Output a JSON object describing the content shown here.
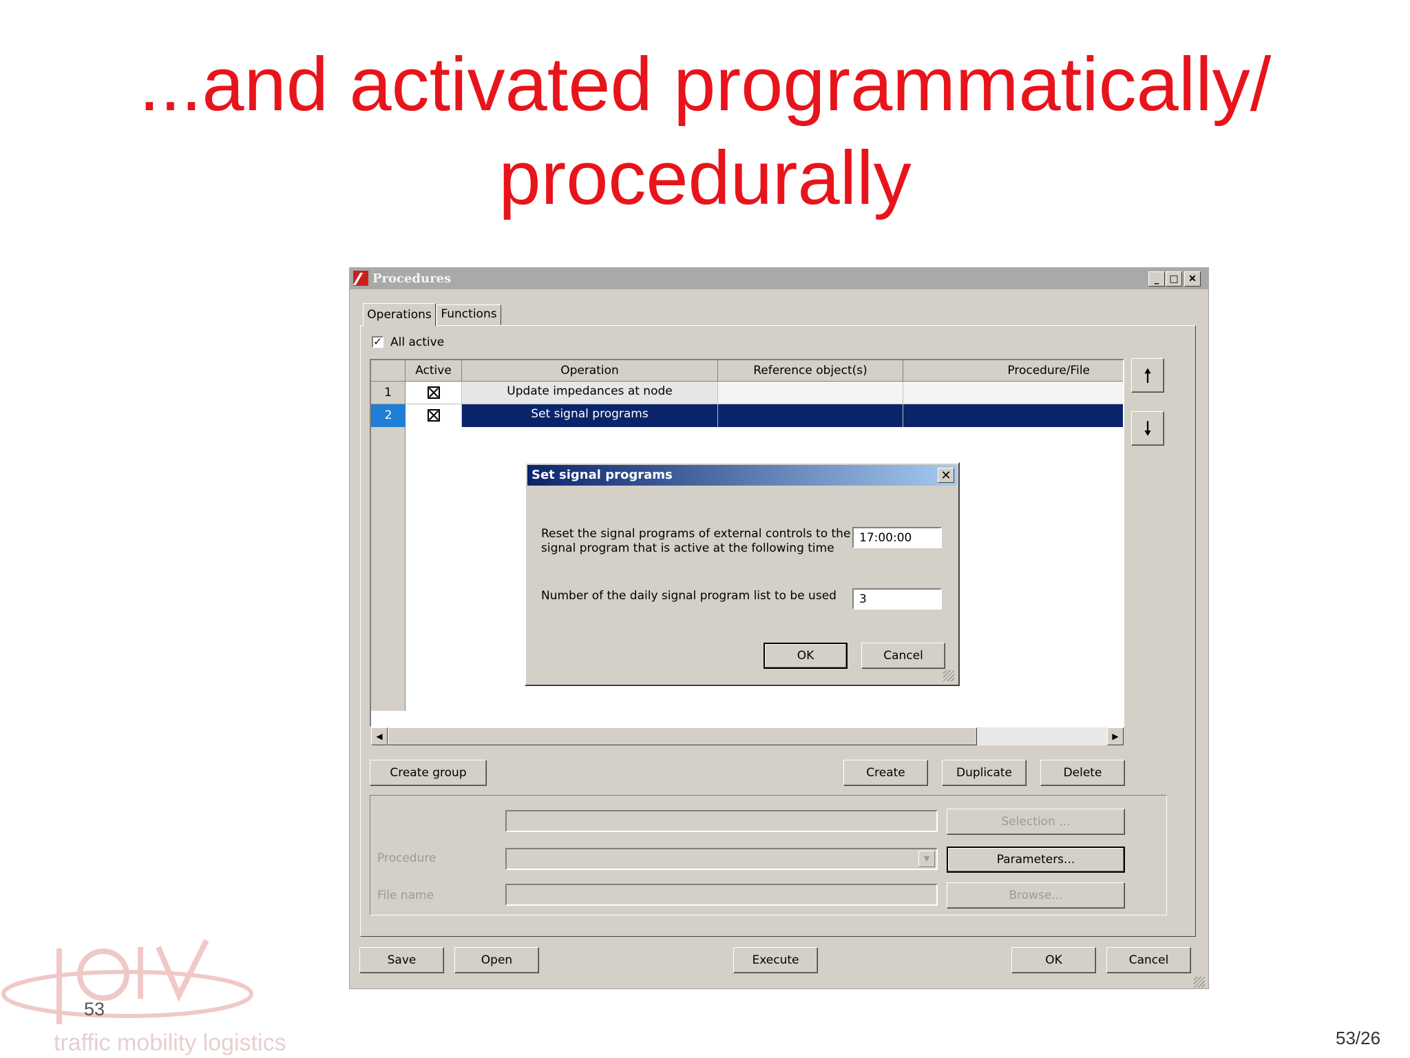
{
  "slide": {
    "title_line1": "...and activated programmatically/",
    "title_line2": "procedurally",
    "slide_number": "53",
    "page_counter": "53/26",
    "logo_text": "traffic mobility logistics"
  },
  "window": {
    "title": "Procedures",
    "tabs": [
      {
        "label": "Operations"
      },
      {
        "label": "Functions"
      }
    ],
    "all_active_label": "All active",
    "table": {
      "columns": [
        "Active",
        "Operation",
        "Reference object(s)",
        "Procedure/File"
      ],
      "rows": [
        {
          "num": "1",
          "operation": "Update impedances at node",
          "reference": "",
          "procedure": ""
        },
        {
          "num": "2",
          "operation": "Set signal programs",
          "reference": "",
          "procedure": ""
        }
      ]
    },
    "buttons": {
      "create_group": "Create group",
      "create": "Create",
      "duplicate": "Duplicate",
      "delete": "Delete",
      "selection": "Selection ...",
      "parameters": "Parameters...",
      "browse": "Browse...",
      "save": "Save",
      "open": "Open",
      "execute": "Execute",
      "ok": "OK",
      "cancel": "Cancel"
    },
    "fields": {
      "procedure_label": "Procedure",
      "file_name_label": "File name"
    }
  },
  "dialog": {
    "title": "Set signal programs",
    "reset_line1": "Reset the signal programs of external controls to the",
    "reset_line2": "signal program that is active at the following time",
    "time_value": "17:00:00",
    "number_label": "Number of the daily signal program list to be used",
    "number_value": "3",
    "ok": "OK",
    "cancel": "Cancel"
  },
  "colors": {
    "title_red": "#e8141b",
    "selection_blue": "#0a246a",
    "dialog_title_gradient_end": "#a6caf0"
  }
}
